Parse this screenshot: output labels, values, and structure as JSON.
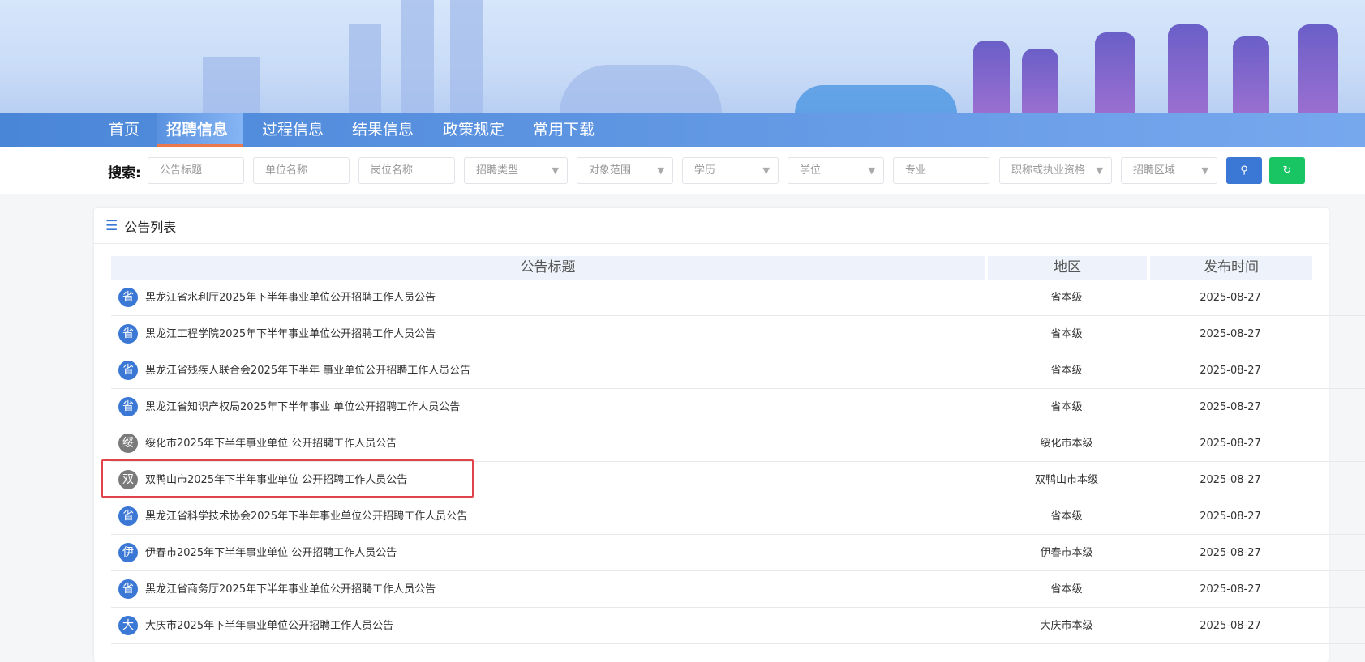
{
  "nav": {
    "items": [
      "首页",
      "招聘信息",
      "过程信息",
      "结果信息",
      "政策规定",
      "常用下载"
    ],
    "active": 1
  },
  "search": {
    "label": "搜索:",
    "fields": [
      "公告标题",
      "单位名称",
      "岗位名称",
      "招聘类型",
      "对象范围",
      "学历",
      "学位",
      "专业",
      "职称或执业资格",
      "招聘区域"
    ],
    "search_icon": "search-icon",
    "reset_icon": "refresh-icon"
  },
  "card": {
    "title": "公告列表",
    "headers": [
      "公告标题",
      "地区",
      "发布时间"
    ],
    "rows": [
      {
        "badge": "省",
        "title": "黑龙江省水利厅2025年下半年事业单位公开招聘工作人员公告",
        "region": "省本级",
        "date": "2025-08-27"
      },
      {
        "badge": "省",
        "title": "黑龙江工程学院2025年下半年事业单位公开招聘工作人员公告",
        "region": "省本级",
        "date": "2025-08-27"
      },
      {
        "badge": "省",
        "title": "黑龙江省残疾人联合会2025年下半年 事业单位公开招聘工作人员公告",
        "region": "省本级",
        "date": "2025-08-27"
      },
      {
        "badge": "省",
        "title": "黑龙江省知识产权局2025年下半年事业 单位公开招聘工作人员公告",
        "region": "省本级",
        "date": "2025-08-27"
      },
      {
        "badge": "绥",
        "title": "绥化市2025年下半年事业单位 公开招聘工作人员公告",
        "region": "绥化市本级",
        "date": "2025-08-27"
      },
      {
        "badge": "双",
        "title": "双鸭山市2025年下半年事业单位 公开招聘工作人员公告",
        "region": "双鸭山市本级",
        "date": "2025-08-27"
      },
      {
        "badge": "省",
        "title": "黑龙江省科学技术协会2025年下半年事业单位公开招聘工作人员公告",
        "region": "省本级",
        "date": "2025-08-27"
      },
      {
        "badge": "伊",
        "title": "伊春市2025年下半年事业单位 公开招聘工作人员公告",
        "region": "伊春市本级",
        "date": "2025-08-27"
      },
      {
        "badge": "省",
        "title": "黑龙江省商务厅2025年下半年事业单位公开招聘工作人员公告",
        "region": "省本级",
        "date": "2025-08-27"
      },
      {
        "badge": "大",
        "title": "大庆市2025年下半年事业单位公开招聘工作人员公告",
        "region": "大庆市本级",
        "date": "2025-08-27"
      }
    ]
  },
  "colors": {
    "blue_badge": "#3b78d6",
    "gray_badge": "#7a7a7a",
    "highlight": "#e0444a",
    "search_btn": "#3b78d6",
    "reset_btn": "#19c463"
  }
}
